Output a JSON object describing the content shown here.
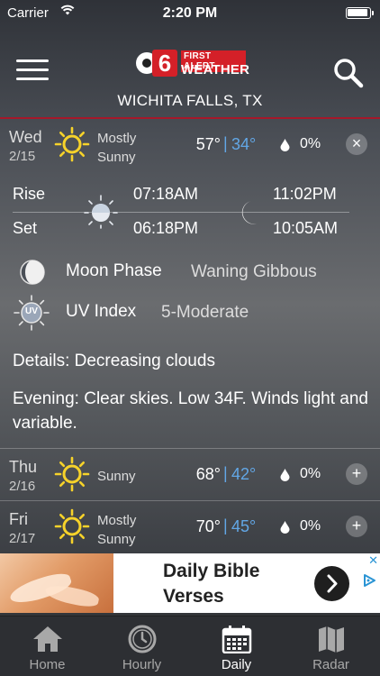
{
  "status_bar": {
    "carrier": "Carrier",
    "time": "2:20 PM",
    "icons": [
      "wifi-icon",
      "battery-icon"
    ]
  },
  "header": {
    "logo": {
      "channel": "6",
      "line1": "FIRST ALERT",
      "line2": "WEATHER"
    },
    "location": "WICHITA FALLS, TX",
    "accent_color": "#a6182a"
  },
  "days": [
    {
      "day": "Wed",
      "date": "2/15",
      "condition": "Mostly Sunny",
      "high": "57°",
      "separator": "|",
      "low": "34°",
      "precip": "0%",
      "action": "×",
      "expanded": true
    },
    {
      "day": "Thu",
      "date": "2/16",
      "condition": "Sunny",
      "high": "68°",
      "separator": "|",
      "low": "42°",
      "precip": "0%",
      "action": "+",
      "expanded": false
    },
    {
      "day": "Fri",
      "date": "2/17",
      "condition": "Mostly Sunny",
      "high": "70°",
      "separator": "|",
      "low": "45°",
      "precip": "0%",
      "action": "+",
      "expanded": false
    }
  ],
  "detail": {
    "rise_label": "Rise",
    "set_label": "Set",
    "sunrise": "07:18AM",
    "sunset": "06:18PM",
    "moonrise": "11:02PM",
    "moonset": "10:05AM",
    "moon_phase_label": "Moon Phase",
    "moon_phase": "Waning Gibbous",
    "uv_label": "UV Index",
    "uv_icon_text": "UV",
    "uv_value": "5-Moderate",
    "details": "Details: Decreasing clouds",
    "evening": "Evening: Clear skies. Low 34F. Winds light and variable."
  },
  "ad": {
    "title": "Daily Bible Verses",
    "adchoices_color": "#2a94d4"
  },
  "tabs": [
    {
      "label": "Home",
      "icon": "home-icon",
      "active": false
    },
    {
      "label": "Hourly",
      "icon": "clock-icon",
      "active": false
    },
    {
      "label": "Daily",
      "icon": "calendar-icon",
      "active": true
    },
    {
      "label": "Radar",
      "icon": "map-icon",
      "active": false
    }
  ],
  "colors": {
    "low_temp": "#62a7e6",
    "sun_yellow": "#f6d22a",
    "brand_red": "#d42028"
  }
}
